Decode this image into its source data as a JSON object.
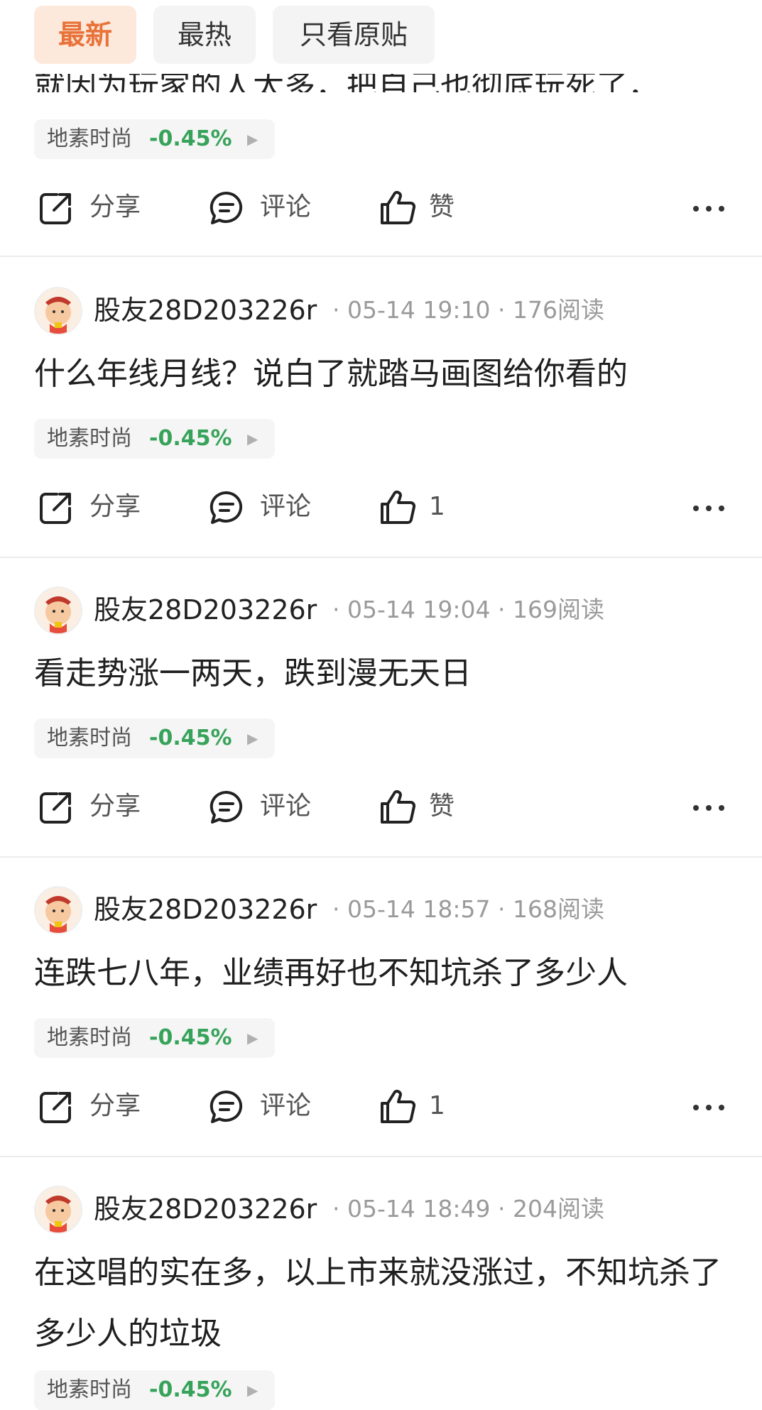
{
  "tabs": [
    {
      "label": "最新",
      "active": true
    },
    {
      "label": "最热",
      "active": false
    },
    {
      "label": "只看原贴",
      "active": false
    }
  ],
  "partial_post": {
    "text": "就因为玩家的人太多，把自己也彻底玩死了，",
    "stock_tag": {
      "name": "地素时尚",
      "change": "-0.45%"
    },
    "actions": {
      "share": "分享",
      "comment": "评论",
      "like": "赞"
    }
  },
  "posts": [
    {
      "user": "股友28D203226r",
      "time": "05-14 19:10",
      "reads": "176阅读",
      "text": "什么年线月线？说白了就踏马画图给你看的",
      "stock_tag": {
        "name": "地素时尚",
        "change": "-0.45%"
      },
      "actions": {
        "share": "分享",
        "comment": "评论",
        "like": "1"
      }
    },
    {
      "user": "股友28D203226r",
      "time": "05-14 19:04",
      "reads": "169阅读",
      "text": "看走势涨一两天，跌到漫无天日",
      "stock_tag": {
        "name": "地素时尚",
        "change": "-0.45%"
      },
      "actions": {
        "share": "分享",
        "comment": "评论",
        "like": "赞"
      }
    },
    {
      "user": "股友28D203226r",
      "time": "05-14 18:57",
      "reads": "168阅读",
      "text": "连跌七八年，业绩再好也不知坑杀了多少人",
      "stock_tag": {
        "name": "地素时尚",
        "change": "-0.45%"
      },
      "actions": {
        "share": "分享",
        "comment": "评论",
        "like": "1"
      }
    },
    {
      "user": "股友28D203226r",
      "time": "05-14 18:49",
      "reads": "204阅读",
      "text": "在这唱的实在多，以上市来就没涨过，不知坑杀了多少人的垃圾",
      "stock_tag": {
        "name": "地素时尚",
        "change": "-0.45%"
      }
    }
  ],
  "colors": {
    "accent": "#e8733a",
    "positive_change": "#37a35a"
  }
}
